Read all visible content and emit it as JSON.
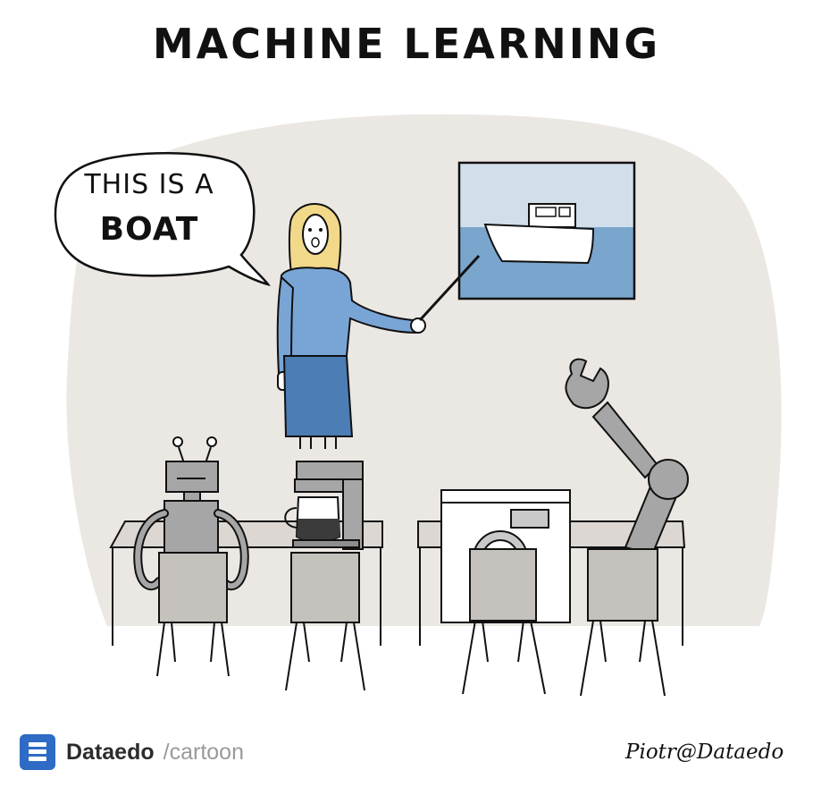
{
  "title": "MACHINE LEARNING",
  "speech": {
    "line1": "THIS IS A",
    "line2": "BOAT"
  },
  "brand": {
    "name": "Dataedo",
    "sub": "/cartoon"
  },
  "signature": "Piotr@Dataedo",
  "colors": {
    "room_blob": "#ebe7e3",
    "sweater": "#79a5d6",
    "skirt": "#4c7db5",
    "hair": "#f2d98a",
    "sky": "#d2dfea",
    "sea": "#7aa5cc",
    "chair": "#c5c1bd",
    "robot_grey": "#a6a6a6",
    "table": "#dcd7d2",
    "brand_blue": "#2e6bc4"
  },
  "icons": [
    "dataedo-logo-icon"
  ]
}
